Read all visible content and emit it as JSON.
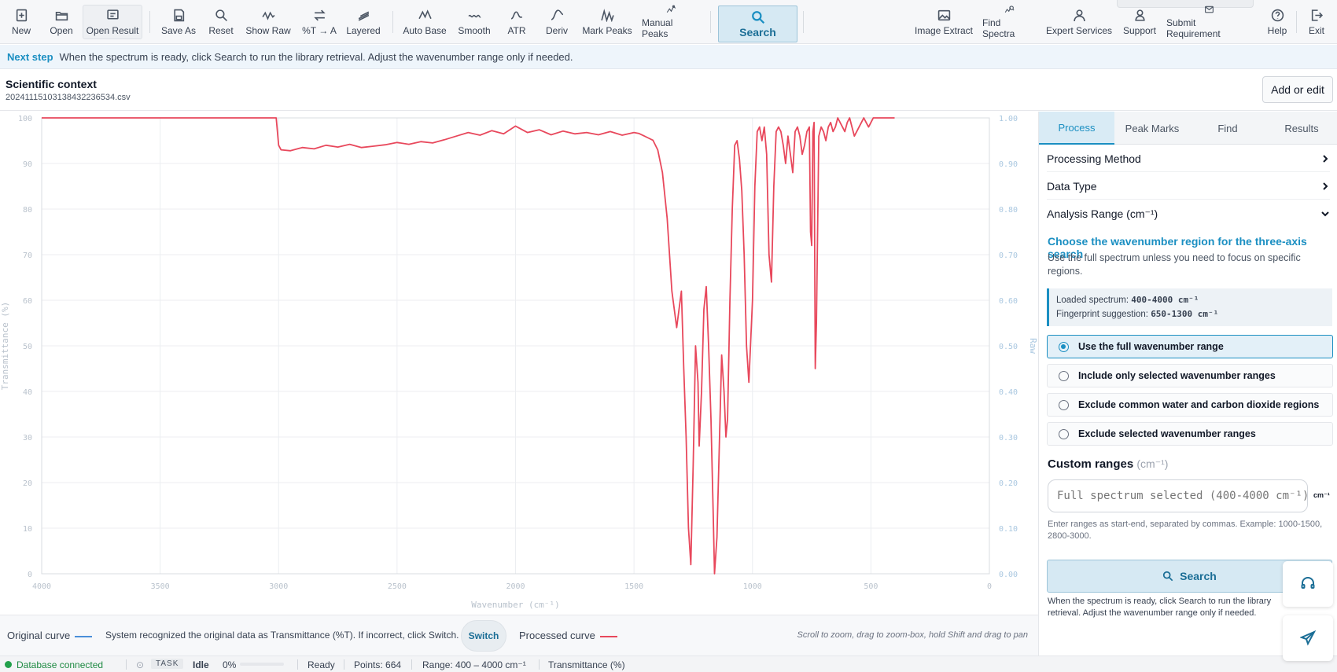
{
  "toolbar": {
    "left_buttons": [
      {
        "label": "New",
        "icon": "new-file-icon"
      },
      {
        "label": "Open",
        "icon": "open-folder-icon"
      },
      {
        "label": "Open Result",
        "icon": "open-result-icon"
      },
      {
        "label": "Save As",
        "icon": "save-icon"
      },
      {
        "label": "Reset",
        "icon": "search-reset-icon"
      },
      {
        "label": "Show Raw",
        "icon": "wave-icon"
      },
      {
        "label": "%T → A",
        "icon": "swap-icon"
      },
      {
        "label": "Layered",
        "icon": "layers-icon"
      },
      {
        "label": "Auto Base",
        "icon": "baseline-icon"
      },
      {
        "label": "Smooth",
        "icon": "smooth-icon"
      },
      {
        "label": "ATR",
        "icon": "atr-icon"
      },
      {
        "label": "Deriv",
        "icon": "derivative-icon"
      },
      {
        "label": "Mark Peaks",
        "icon": "peaks-icon"
      },
      {
        "label": "Manual Peaks",
        "icon": "manual-peaks-icon"
      }
    ],
    "search_label": "Search",
    "right_buttons": [
      {
        "label": "Image Extract",
        "icon": "image-icon"
      },
      {
        "label": "Find Spectra",
        "icon": "find-spectra-icon"
      },
      {
        "label": "Expert Services",
        "icon": "expert-icon"
      },
      {
        "label": "Support",
        "icon": "support-icon"
      },
      {
        "label": "Submit Requirement",
        "icon": "mail-icon"
      },
      {
        "label": "Help",
        "icon": "help-icon"
      },
      {
        "label": "Exit",
        "icon": "exit-icon"
      }
    ]
  },
  "banner": {
    "label": "Next step",
    "text": "When the spectrum is ready, click Search to run the library retrieval. Adjust the wavenumber range only if needed."
  },
  "context": {
    "title": "Scientific context",
    "file": "20241115103138432236534.csv",
    "add_edit": "Add or edit"
  },
  "chart_data": {
    "type": "line",
    "xlabel": "Wavenumber (cm⁻¹)",
    "ylabel": "Transmittance (%)",
    "ylabel_right": "Raw",
    "xlim": [
      4000,
      0
    ],
    "ylim": [
      0,
      100
    ],
    "ylim_right": [
      0,
      1
    ],
    "x_ticks": [
      4000,
      3500,
      3000,
      2500,
      2000,
      1500,
      1000,
      500,
      0
    ],
    "y_ticks": [
      0,
      10,
      20,
      30,
      40,
      50,
      60,
      70,
      80,
      90,
      100
    ],
    "y_ticks_right": [
      "0.00",
      "0.10",
      "0.20",
      "0.30",
      "0.40",
      "0.50",
      "0.60",
      "0.70",
      "0.80",
      "0.90",
      "1.00"
    ],
    "grid": true,
    "series": [
      {
        "name": "Processed curve",
        "color": "#e8485c",
        "x": [
          4000,
          3010,
          3000,
          2990,
          2950,
          2900,
          2850,
          2800,
          2750,
          2700,
          2650,
          2600,
          2550,
          2500,
          2450,
          2400,
          2350,
          2300,
          2250,
          2200,
          2150,
          2100,
          2050,
          2000,
          1950,
          1900,
          1850,
          1800,
          1750,
          1700,
          1650,
          1600,
          1550,
          1500,
          1480,
          1460,
          1440,
          1420,
          1400,
          1380,
          1360,
          1340,
          1320,
          1300,
          1290,
          1280,
          1270,
          1260,
          1250,
          1240,
          1230,
          1225,
          1215,
          1205,
          1195,
          1185,
          1175,
          1165,
          1160,
          1150,
          1140,
          1130,
          1120,
          1112,
          1105,
          1095,
          1085,
          1075,
          1065,
          1055,
          1045,
          1035,
          1025,
          1015,
          1000,
          990,
          980,
          970,
          960,
          950,
          940,
          930,
          920,
          910,
          900,
          890,
          880,
          870,
          860,
          850,
          840,
          830,
          820,
          810,
          800,
          790,
          780,
          770,
          760,
          755,
          750,
          745,
          740,
          735,
          730,
          720,
          710,
          700,
          690,
          680,
          670,
          660,
          650,
          640,
          630,
          620,
          610,
          600,
          590,
          580,
          570,
          560,
          550,
          540,
          530,
          520,
          510,
          500,
          490,
          480,
          470,
          460,
          450,
          440,
          430,
          420,
          410,
          400
        ],
        "y": [
          100,
          100,
          94,
          93,
          92.8,
          93.5,
          93.2,
          94,
          93.6,
          94.2,
          93.5,
          93.8,
          94.1,
          94.6,
          94.2,
          94.8,
          94.5,
          95.2,
          96,
          96.8,
          96.2,
          97.2,
          96.5,
          98.2,
          96.8,
          97.4,
          96.3,
          97.1,
          96.5,
          96.8,
          96.3,
          97,
          96.2,
          96.8,
          96.6,
          96.1,
          95.6,
          95.1,
          93,
          88,
          78,
          62,
          54,
          62,
          45,
          30,
          10,
          2,
          24,
          50,
          42,
          28,
          40,
          58,
          63,
          50,
          34,
          12,
          0,
          8,
          28,
          48,
          40,
          30,
          34,
          60,
          80,
          94,
          95,
          91,
          84,
          70,
          50,
          42,
          60,
          85,
          97,
          98,
          95,
          98,
          92,
          70,
          64,
          85,
          97,
          98,
          97,
          94,
          90,
          96,
          92,
          88,
          97,
          98,
          96,
          92,
          94,
          97,
          98,
          75,
          72,
          97,
          99,
          45,
          55,
          96,
          98,
          97,
          95,
          98,
          99,
          97,
          98,
          100,
          99,
          98,
          97,
          99,
          100,
          98,
          96,
          97,
          98,
          99,
          100,
          99,
          98,
          99,
          100,
          100,
          100,
          100,
          100,
          100,
          100,
          100,
          100,
          100
        ]
      },
      {
        "name": "Original curve",
        "color": "#4a8fd9",
        "x": [],
        "y": []
      }
    ]
  },
  "curve_bar": {
    "original_label": "Original curve",
    "original_color": "#4a8fd9",
    "recognized_text": "System recognized the original data as Transmittance (%T). If incorrect, click Switch.",
    "switch_label": "Switch",
    "processed_label": "Processed curve",
    "processed_color": "#e8485c",
    "hint": "Scroll to zoom, drag to zoom-box, hold Shift and drag to pan"
  },
  "status": {
    "db": "Database connected",
    "task": "TASK",
    "task_state": "Idle",
    "progress": "0%",
    "progress_value": 0,
    "ready": "Ready",
    "points": "Points: 664",
    "range": "Range: 400 – 4000 cm⁻¹",
    "mode": "Transmittance (%)"
  },
  "panel": {
    "tabs": [
      "Process",
      "Peak Marks",
      "Find",
      "Results"
    ],
    "active_tab": "Process",
    "accordions": [
      "Processing Method",
      "Data Type",
      "Analysis Range (cm⁻¹)"
    ],
    "section_title": "Choose the wavenumber region for the three-axis search",
    "section_desc": "Use the full spectrum unless you need to focus on specific regions.",
    "loaded_label": "Loaded spectrum:",
    "loaded_value": "400-4000 cm⁻¹",
    "fingerprint_label": "Fingerprint suggestion:",
    "fingerprint_value": "650-1300 cm⁻¹",
    "options": [
      "Use the full wavenumber range",
      "Include only selected wavenumber ranges",
      "Exclude common water and carbon dioxide regions",
      "Exclude selected wavenumber ranges"
    ],
    "selected_option": 0,
    "custom_title": "Custom ranges",
    "custom_unit": "(cm⁻¹)",
    "custom_placeholder": "Full spectrum selected (400-4000 cm⁻¹)",
    "unit_label": "cm⁻¹",
    "range_help": "Enter ranges as start-end, separated by commas. Example: 1000-1500, 2800-3000.",
    "search_label": "Search",
    "note": "When the spectrum is ready, click Search to run the library retrieval. Adjust the wavenumber range only if needed."
  }
}
